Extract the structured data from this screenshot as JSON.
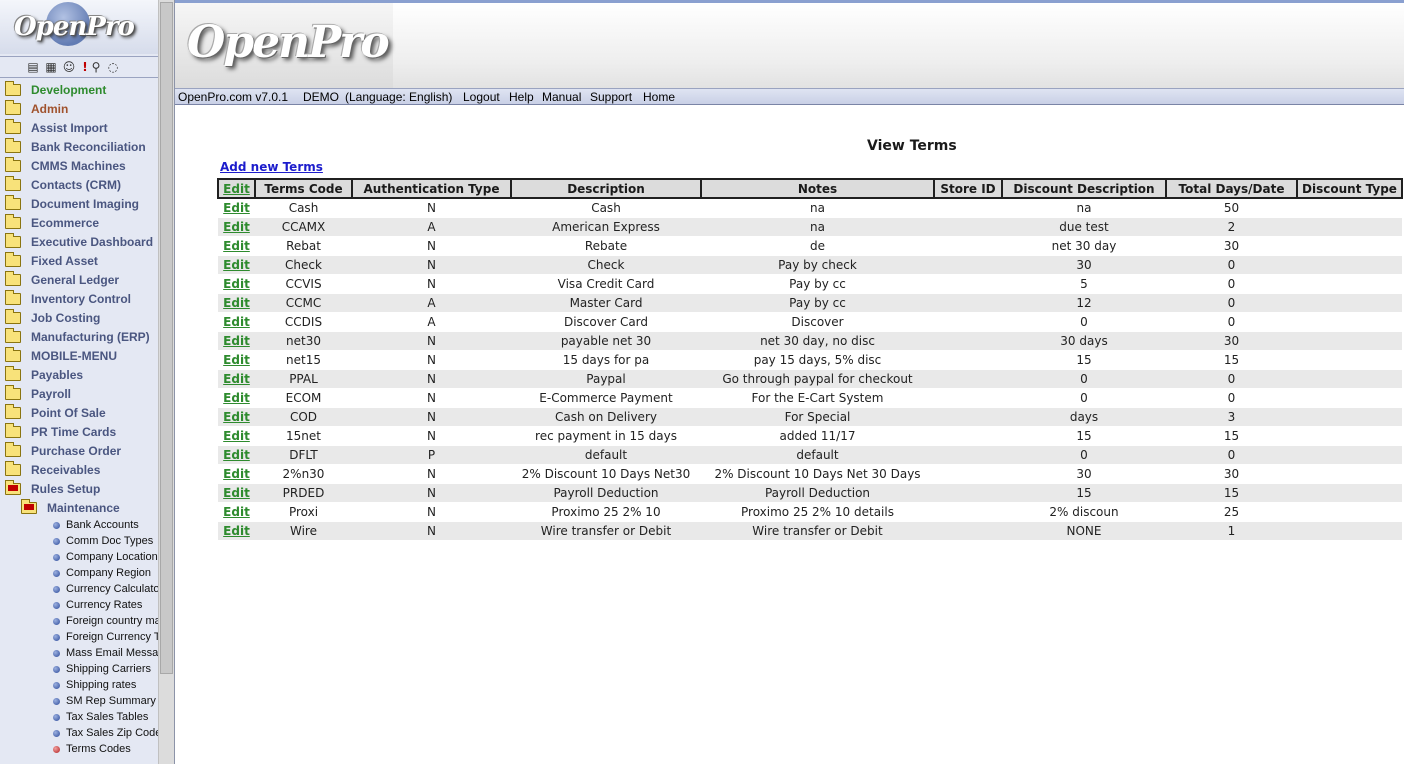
{
  "app": {
    "logo_text": "OpenPro",
    "header_brand": "OpenPro"
  },
  "sidebar": {
    "toolbar_icons": [
      "printer-icon",
      "calculator-icon",
      "users-icon",
      "alert-icon",
      "search-icon",
      "chat-icon"
    ],
    "menu": [
      {
        "label": "Development",
        "style": "dev"
      },
      {
        "label": "Admin",
        "style": "adm"
      },
      {
        "label": "Assist Import"
      },
      {
        "label": "Bank Reconciliation"
      },
      {
        "label": "CMMS Machines"
      },
      {
        "label": "Contacts (CRM)"
      },
      {
        "label": "Document Imaging"
      },
      {
        "label": "Ecommerce"
      },
      {
        "label": "Executive Dashboard"
      },
      {
        "label": "Fixed Asset"
      },
      {
        "label": "General Ledger"
      },
      {
        "label": "Inventory Control"
      },
      {
        "label": "Job Costing"
      },
      {
        "label": "Manufacturing (ERP)"
      },
      {
        "label": "MOBILE-MENU"
      },
      {
        "label": "Payables"
      },
      {
        "label": "Payroll"
      },
      {
        "label": "Point Of Sale"
      },
      {
        "label": "PR Time Cards"
      },
      {
        "label": "Purchase Order"
      },
      {
        "label": "Receivables"
      },
      {
        "label": "Rules Setup",
        "open": true
      },
      {
        "label": "Maintenance",
        "open": true,
        "sub": true
      }
    ],
    "leaves": [
      {
        "label": "Bank Accounts"
      },
      {
        "label": "Comm Doc Types"
      },
      {
        "label": "Company Locations"
      },
      {
        "label": "Company Region"
      },
      {
        "label": "Currency Calculator"
      },
      {
        "label": "Currency Rates"
      },
      {
        "label": "Foreign country ma"
      },
      {
        "label": "Foreign Currency T"
      },
      {
        "label": "Mass Email Messag"
      },
      {
        "label": "Shipping Carriers"
      },
      {
        "label": "Shipping rates"
      },
      {
        "label": "SM Rep Summary M"
      },
      {
        "label": "Tax Sales Tables"
      },
      {
        "label": "Tax Sales Zip Code"
      },
      {
        "label": "Terms Codes",
        "active": true
      }
    ]
  },
  "topbar": {
    "version": "OpenPro.com v7.0.1",
    "mode": "DEMO",
    "language": "(Language: English)",
    "logout": "Logout",
    "help": "Help",
    "manual": "Manual",
    "support": "Support",
    "home": "Home"
  },
  "main": {
    "title": "View Terms",
    "add_link": "Add new Terms",
    "columns": [
      "Edit",
      "Terms Code",
      "Authentication Type",
      "Description",
      "Notes",
      "Store ID",
      "Discount Description",
      "Total Days/Date",
      "Discount Type"
    ],
    "edit_label": "Edit",
    "rows": [
      [
        "Cash",
        "N",
        "Cash",
        "na",
        "",
        "na",
        "50",
        ""
      ],
      [
        "CCAMX",
        "A",
        "American Express",
        "na",
        "",
        "due test",
        "2",
        ""
      ],
      [
        "Rebat",
        "N",
        "Rebate",
        "de",
        "",
        "net 30 day",
        "30",
        ""
      ],
      [
        "Check",
        "N",
        "Check",
        "Pay by check",
        "",
        "30",
        "0",
        ""
      ],
      [
        "CCVIS",
        "N",
        "Visa Credit Card",
        "Pay by cc",
        "",
        "5",
        "0",
        ""
      ],
      [
        "CCMC",
        "A",
        "Master Card",
        "Pay by cc",
        "",
        "12",
        "0",
        ""
      ],
      [
        "CCDIS",
        "A",
        "Discover Card",
        "Discover",
        "",
        "0",
        "0",
        ""
      ],
      [
        "net30",
        "N",
        "payable net 30",
        "net 30 day, no disc",
        "",
        "30 days",
        "30",
        ""
      ],
      [
        "net15",
        "N",
        "15 days for pa",
        "pay 15 days, 5% disc",
        "",
        "15",
        "15",
        ""
      ],
      [
        "PPAL",
        "N",
        "Paypal",
        "Go through paypal for checkout",
        "",
        "0",
        "0",
        ""
      ],
      [
        "ECOM",
        "N",
        "E-Commerce Payment",
        "For the E-Cart System",
        "",
        "0",
        "0",
        ""
      ],
      [
        "COD",
        "N",
        "Cash on Delivery",
        "For Special",
        "",
        "days",
        "3",
        ""
      ],
      [
        "15net",
        "N",
        "rec payment in 15 days",
        "added 11/17",
        "",
        "15",
        "15",
        ""
      ],
      [
        "DFLT",
        "P",
        "default",
        "default",
        "",
        "0",
        "0",
        ""
      ],
      [
        "2%n30",
        "N",
        "2% Discount 10 Days Net30",
        "2% Discount 10 Days Net 30 Days",
        "",
        "30",
        "30",
        ""
      ],
      [
        "PRDED",
        "N",
        "Payroll Deduction",
        "Payroll Deduction",
        "",
        "15",
        "15",
        ""
      ],
      [
        "Proxi",
        "N",
        "Proximo 25 2% 10",
        "Proximo 25 2% 10 details",
        "",
        "2% discoun",
        "25",
        ""
      ],
      [
        "Wire",
        "N",
        "Wire transfer or Debit",
        "Wire transfer or Debit",
        "",
        "NONE",
        "1",
        ""
      ]
    ]
  }
}
